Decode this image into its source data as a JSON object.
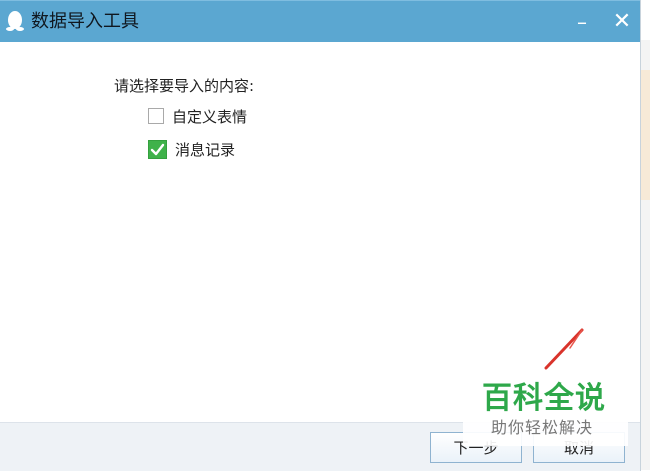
{
  "window": {
    "title": "数据导入工具",
    "minimize_glyph": "–",
    "close_glyph": "✕",
    "icon": "penguin-icon"
  },
  "content": {
    "prompt": "请选择要导入的内容:",
    "options": [
      {
        "label": "自定义表情",
        "checked": false
      },
      {
        "label": "消息记录",
        "checked": true
      }
    ]
  },
  "footer": {
    "next_label": "下一步",
    "cancel_label": "取消"
  },
  "watermark": {
    "brand": "百科全说",
    "slogan": "助你轻松解决"
  },
  "colors": {
    "titlebar": "#5ba7d1",
    "checkbox_checked": "#3fb24a",
    "watermark_green": "#2ea84a",
    "annotation_red": "#d9332b"
  }
}
